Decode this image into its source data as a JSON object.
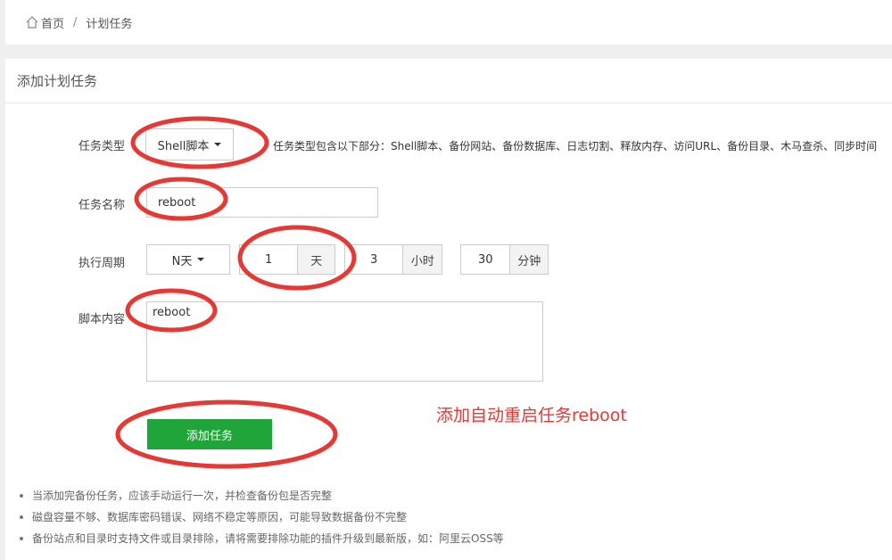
{
  "breadcrumb": {
    "home": "首页",
    "separator": "/",
    "current": "计划任务"
  },
  "panel": {
    "title": "添加计划任务"
  },
  "form": {
    "task_type": {
      "label": "任务类型",
      "value": "Shell脚本",
      "hint": "任务类型包含以下部分：Shell脚本、备份网站、备份数据库、日志切割、释放内存、访问URL、备份目录、木马查杀、同步时间"
    },
    "task_name": {
      "label": "任务名称",
      "value": "reboot"
    },
    "period": {
      "label": "执行周期",
      "type": "N天",
      "days": "1",
      "days_unit": "天",
      "hours": "3",
      "hours_unit": "小时",
      "minutes": "30",
      "minutes_unit": "分钟"
    },
    "script": {
      "label": "脚本内容",
      "value": "reboot"
    },
    "submit_label": "添加任务"
  },
  "annotation_text": "添加自动重启任务reboot",
  "tips": [
    "当添加完备份任务，应该手动运行一次，并检查备份包是否完整",
    "磁盘容量不够、数据库密码错误、网络不稳定等原因，可能导致数据备份不完整",
    "备份站点和目录时支持文件或目录排除，请将需要排除功能的插件升级到最新版，如：阿里云OSS等"
  ],
  "colors": {
    "accent_green": "#20a53a",
    "annotation_red": "#e53935"
  }
}
